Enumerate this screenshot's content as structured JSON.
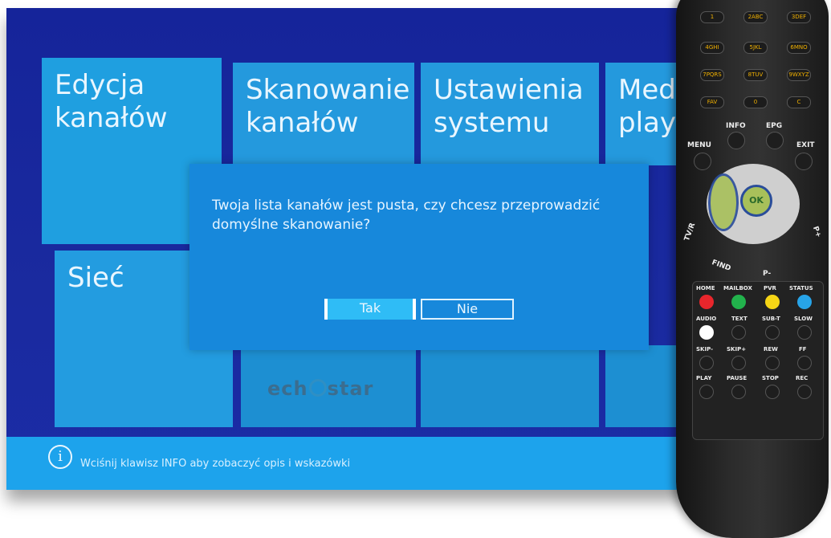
{
  "tiles": [
    {
      "label": "Edycja\nkanałów"
    },
    {
      "label": "Skanowanie\nkanałów"
    },
    {
      "label": "Ustawienia\nsystemu"
    },
    {
      "label": "Med\nplaye"
    },
    {
      "label": "Sieć"
    }
  ],
  "logo": {
    "text_left": "ech",
    "text_right": "star"
  },
  "dialog": {
    "message": "Twoja lista kanałów jest pusta, czy chcesz przeprowadzić domyślne skanowanie?",
    "yes_label": "Tak",
    "no_label": "Nie"
  },
  "footer": {
    "info_symbol": "i",
    "hint": "Wciśnij klawisz INFO aby zobaczyć opis i wskazówki"
  },
  "remote": {
    "keys": [
      "1",
      "2ABC",
      "3DEF",
      "4GHI",
      "5JKL",
      "6MNO",
      "7PQRS",
      "8TUV",
      "9WXYZ",
      "FAV",
      "0",
      "C"
    ],
    "labels": {
      "info": "INFO",
      "epg": "EPG",
      "menu": "MENU",
      "exit": "EXIT",
      "ok": "OK",
      "tv_r": "TV/R",
      "p_plus": "P+",
      "find": "FIND",
      "p_minus": "P-",
      "home": "HOME",
      "mailbox": "MAILBOX",
      "pvr": "PVR",
      "status": "STATUS",
      "audio": "AUDIO",
      "text": "TEXT",
      "sub_t": "SUB-T",
      "slow": "SLOW",
      "skip_minus": "SKIP-",
      "skip_plus": "SKIP+",
      "rew": "REW",
      "ff": "FF",
      "play": "PLAY",
      "pause": "PAUSE",
      "stop": "STOP",
      "rec": "REC"
    }
  },
  "colors": {
    "red": "#e8262c",
    "green": "#22b24c",
    "yellow": "#f5d515",
    "blue": "#27a4e8"
  }
}
